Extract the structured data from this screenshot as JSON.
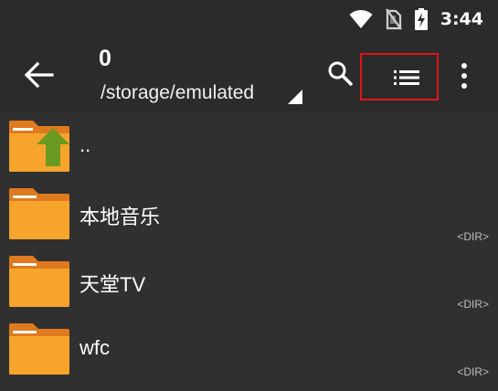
{
  "status_bar": {
    "time": "3:44",
    "icons": [
      "wifi-icon",
      "no-sim-icon",
      "battery-charging-icon"
    ]
  },
  "toolbar": {
    "title": "0",
    "path": "/storage/emulated",
    "icons": [
      "back-arrow-icon",
      "search-icon",
      "list-view-icon",
      "more-vert-icon"
    ]
  },
  "files": [
    {
      "name": "..",
      "tag": "",
      "icon": "folder-up-icon"
    },
    {
      "name": "本地音乐",
      "tag": "<DIR>",
      "icon": "folder-icon"
    },
    {
      "name": "天堂TV",
      "tag": "<DIR>",
      "icon": "folder-icon"
    },
    {
      "name": "wfc",
      "tag": "<DIR>",
      "icon": "folder-icon"
    }
  ],
  "colors": {
    "background": "#303030",
    "toolbar": "#2b2b2b",
    "folder": "#f7a42c",
    "folder_tab": "#e07a1e",
    "up_arrow": "#6a9a22",
    "highlight_border": "#e0141a"
  }
}
